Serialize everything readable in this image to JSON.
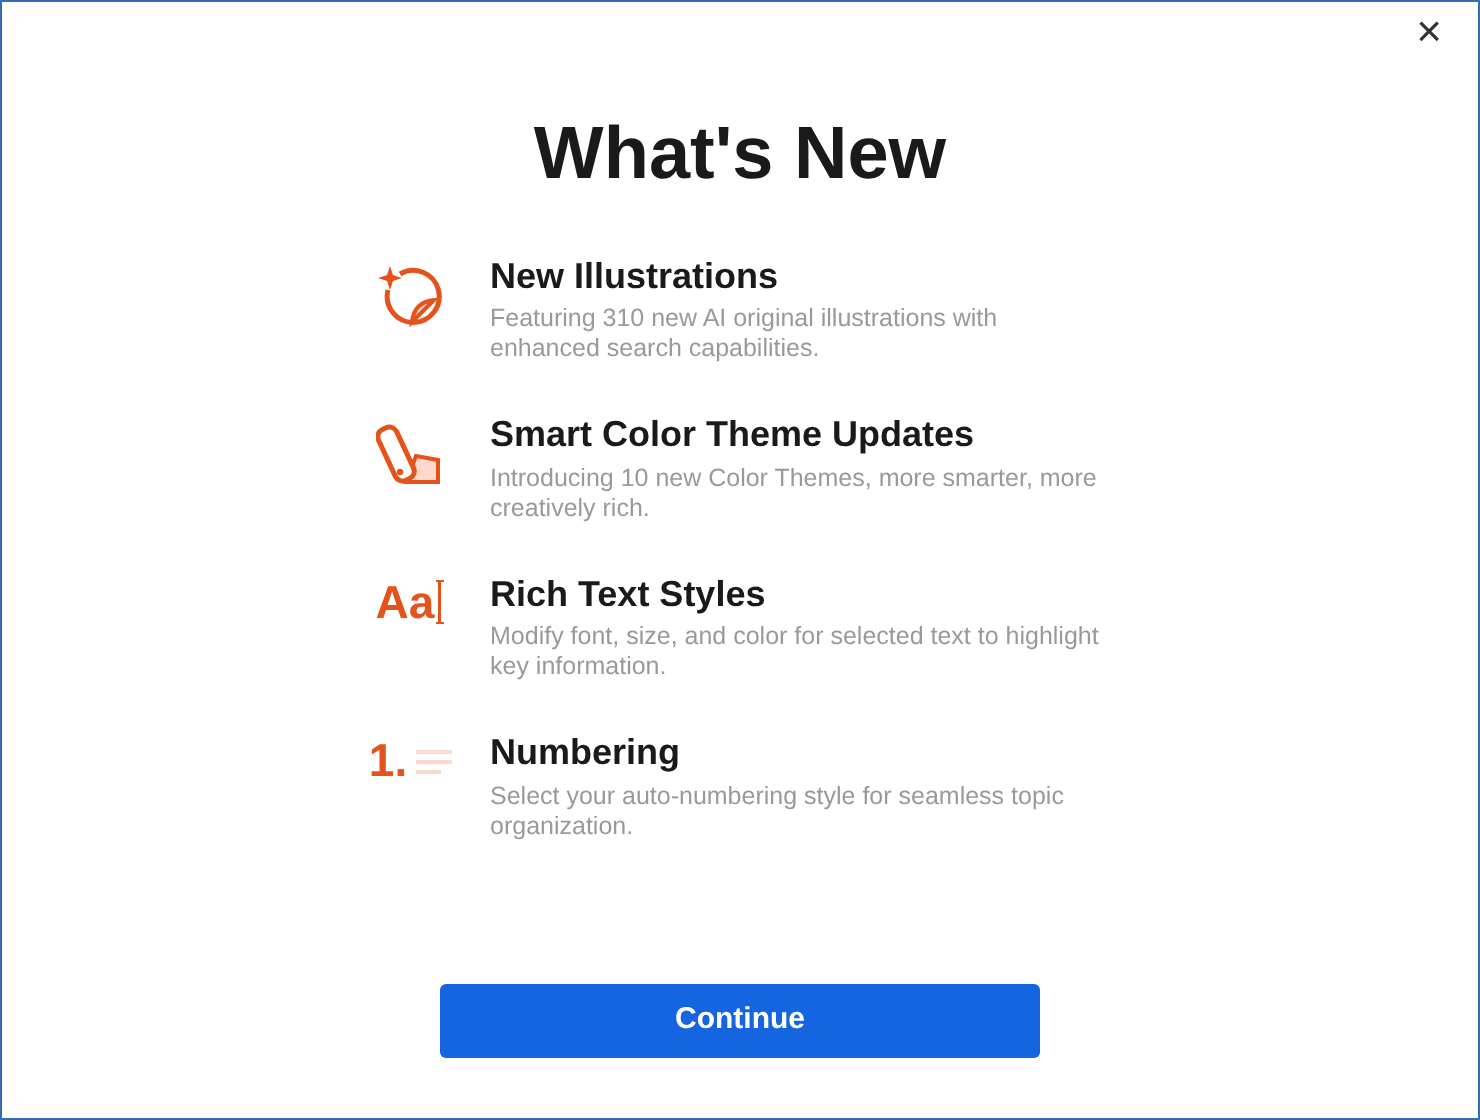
{
  "close_label": "×",
  "title": "What's New",
  "features": [
    {
      "kind": "illustrations",
      "title": "New Illustrations",
      "description": "Featuring 310 new AI original illustrations with enhanced search capabilities."
    },
    {
      "kind": "palette",
      "title": "Smart Color Theme Updates",
      "description": "Introducing 10 new Color Themes, more smarter, more creatively rich."
    },
    {
      "kind": "text",
      "icon_text": "Aa",
      "title": "Rich Text Styles",
      "description": "Modify font, size, and color for selected text to highlight key information."
    },
    {
      "kind": "numbering",
      "icon_text": "1.",
      "title": "Numbering",
      "description": "Select your auto-numbering style for seamless topic organization."
    }
  ],
  "continue_button": "Continue"
}
